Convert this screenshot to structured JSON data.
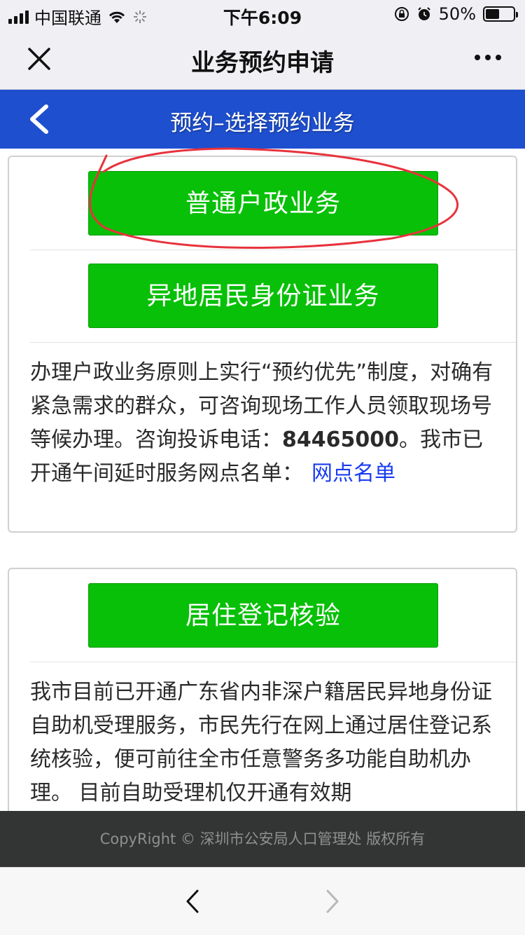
{
  "status_bar": {
    "carrier": "中国联通",
    "time": "下午6:09",
    "battery_percent": "50%",
    "battery_level": 0.5
  },
  "nav": {
    "title": "业务预约申请",
    "close_icon": "close-icon",
    "more_icon": "more-icon"
  },
  "sub_header": {
    "title": "预约–选择预约业务",
    "back_icon": "chevron-left-icon"
  },
  "card1": {
    "button_primary": "普通户政业务",
    "button_secondary": "异地居民身份证业务",
    "notice_prefix": "办理户政业务原则上实行“预约优先”制度，对确有紧急需求的群众，可咨询现场工作人员领取现场号等候办理。咨询投诉电话：",
    "notice_phone": "84465000",
    "notice_suffix": "。我市已开通午间延时服务网点名单：",
    "notice_link": "网点名单"
  },
  "card2": {
    "button": "居住登记核验",
    "notice": "我市目前已开通广东省内非深户籍居民异地身份证自助机受理服务，市民先行在网上通过居住登记系统核验，便可前往全市任意警务多功能自助机办理。 目前自助受理机仅开通有效期"
  },
  "footer": {
    "copyright": "CopyRight © 深圳市公安局人口管理处 版权所有"
  },
  "colors": {
    "blue_bar": "#1e4fcf",
    "green_button": "#08c008",
    "link": "#1a3cf0",
    "annotation": "#e8323c"
  }
}
